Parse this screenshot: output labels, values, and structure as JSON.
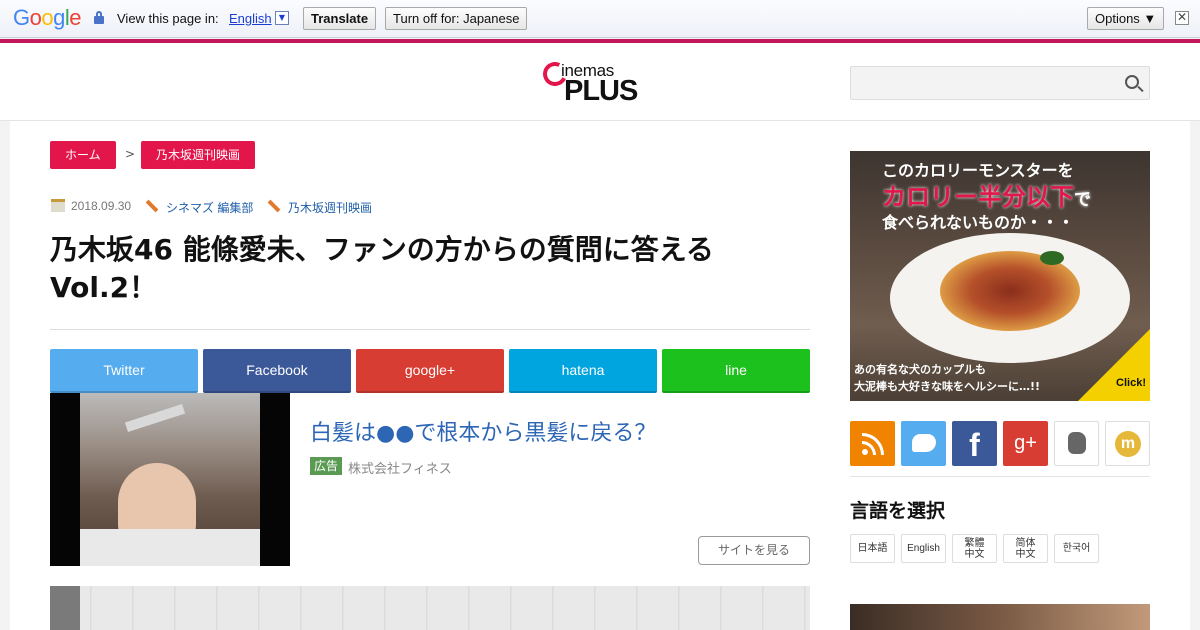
{
  "translate_bar": {
    "logo": "Google",
    "view_text": "View this page in:",
    "language": "English",
    "language_caret": "▼",
    "translate_button": "Translate",
    "turn_off_button": "Turn off for: Japanese",
    "options_button": "Options ▼",
    "close": "✕"
  },
  "header": {
    "logo_top": "inemas",
    "logo_bottom": "PLUS"
  },
  "breadcrumb": {
    "home": "ホーム",
    "separator": ">",
    "category": "乃木坂週刊映画"
  },
  "meta": {
    "date": "2018.09.30",
    "author": "シネマズ 編集部",
    "tag": "乃木坂週刊映画"
  },
  "article": {
    "title": "乃木坂46 能條愛未、ファンの方からの質問に答える Vol.2！"
  },
  "share": {
    "twitter": "Twitter",
    "facebook": "Facebook",
    "google": "google+",
    "hatena": "hatena",
    "line": "line"
  },
  "ad": {
    "headline": "白髪は●●で根本から黒髪に戻る？",
    "badge": "広告",
    "sponsor": "株式会社フィネス",
    "visit_button": "サイトを見る"
  },
  "sidebar": {
    "banner": {
      "line1": "このカロリーモンスターを",
      "line2": "カロリー半分以下",
      "line2_suffix": "で",
      "line3": "食べられないものか・・・",
      "bottom1": "あの有名な犬のカップルも",
      "bottom2": "大泥棒も大好きな味をヘルシーに…!!",
      "click": "Click!"
    },
    "social": {
      "facebook_glyph": "f",
      "google_glyph": "g+",
      "feedly_glyph": "m"
    },
    "language_title": "言語を選択",
    "languages": {
      "ja": "日本語",
      "en": "English",
      "zh_tw_1": "繁體",
      "zh_tw_2": "中文",
      "zh_cn_1": "简体",
      "zh_cn_2": "中文",
      "ko": "한국어"
    }
  },
  "colors": {
    "accent": "#e3164b",
    "link": "#2d66b5",
    "twitter": "#55acee",
    "facebook": "#3b5998",
    "google": "#d73d32",
    "hatena": "#00a4de",
    "line": "#1dc11d"
  }
}
